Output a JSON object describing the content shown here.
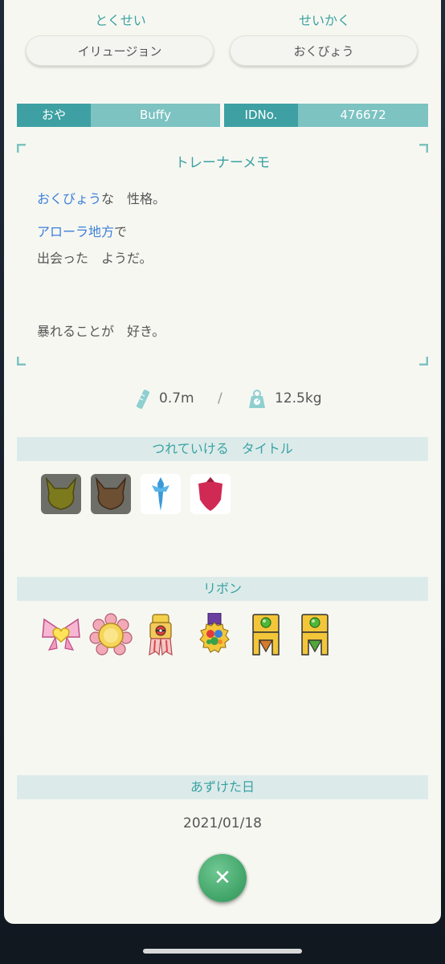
{
  "header": {
    "ability_heading": "とくせい",
    "nature_heading": "せいかく",
    "ability_value": "イリュージョン",
    "nature_value": "おくびょう"
  },
  "trainer": {
    "ot_label": "おや",
    "ot_value": "Buffy",
    "id_label": "IDNo.",
    "id_value": "476672"
  },
  "memo": {
    "title": "トレーナーメモ",
    "line1_highlight": "おくびょう",
    "line1_rest": "な　性格。",
    "line2_highlight": "アローラ地方",
    "line2_rest": "で",
    "line3": "出会った　ようだ。",
    "line4": "暴れることが　好き。"
  },
  "stats": {
    "height": "0.7m",
    "separator": "/",
    "weight": "12.5kg",
    "height_icon": "ruler-icon",
    "weight_icon": "scale-icon"
  },
  "titles": {
    "section_label": "つれていける　タイトル",
    "items": [
      "eevee-silhouette-olive-icon",
      "eevee-silhouette-brown-icon",
      "sword-emblem-icon",
      "shield-emblem-icon"
    ]
  },
  "ribbons": {
    "section_label": "リボン",
    "items": [
      "heart-bow-ribbon",
      "flower-rosette-ribbon",
      "pokeball-medal-ribbon",
      "purple-gem-medal-ribbon",
      "green-orb-champion-ribbon",
      "green-orb-champion-ribbon-2"
    ]
  },
  "deposit": {
    "section_label": "あずけた日",
    "date": "2021/01/18"
  },
  "close": {
    "label": "✕"
  },
  "colors": {
    "accent_teal": "#3aa2a2",
    "highlight_blue": "#3a7fd8",
    "close_green": "#46a86c"
  }
}
